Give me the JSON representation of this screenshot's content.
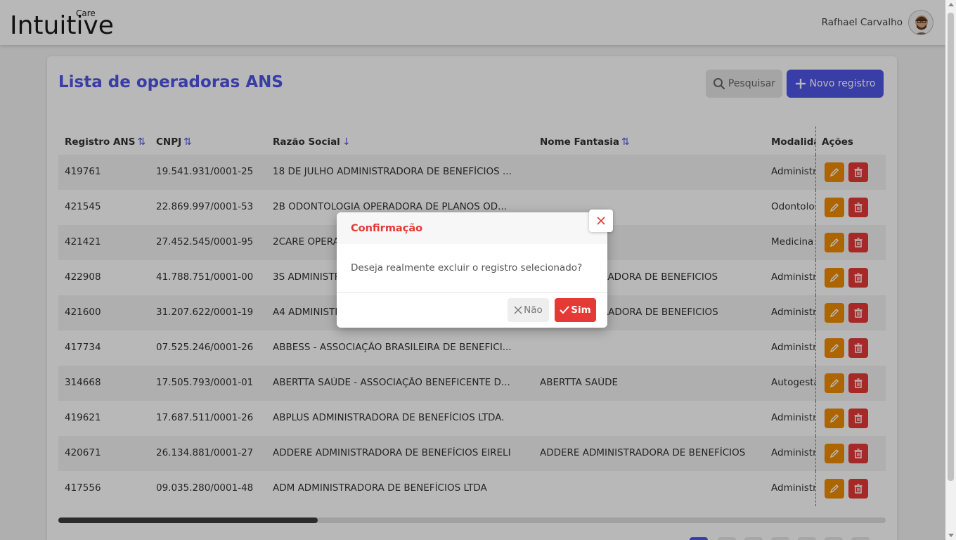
{
  "header": {
    "logo_main": "Intuitive",
    "logo_care": "Care",
    "user_name": "Rafhael Carvalho"
  },
  "page": {
    "title": "Lista de operadoras ANS",
    "search_label": "Pesquisar",
    "new_label": "Novo registro"
  },
  "table": {
    "columns": [
      "Registro ANS",
      "CNPJ",
      "Razão Social",
      "Nome Fantasia",
      "Modalidade",
      "Ações"
    ],
    "rows": [
      {
        "registro": "419761",
        "cnpj": "19.541.931/0001-25",
        "razao": "18 DE JULHO ADMINISTRADORA DE BENEFÍCIOS ...",
        "fantasia": "",
        "modalidade": "Administradora de Benefícios"
      },
      {
        "registro": "421545",
        "cnpj": "22.869.997/0001-53",
        "razao": "2B ODONTOLOGIA OPERADORA DE PLANOS OD...",
        "fantasia": "",
        "modalidade": "Odontologia de Grupo"
      },
      {
        "registro": "421421",
        "cnpj": "27.452.545/0001-95",
        "razao": "2CARE OPERADORA DE SAÚDE LTDA.",
        "fantasia": "",
        "modalidade": "Medicina de Grupo"
      },
      {
        "registro": "422908",
        "cnpj": "41.788.751/0001-00",
        "razao": "3S ADMINISTRADORA DE BENEFICIOS LTDA",
        "fantasia": "3S ADMINISTRADORA DE BENEFICIOS",
        "modalidade": "Administradora de Benefícios"
      },
      {
        "registro": "421600",
        "cnpj": "31.207.622/0001-19",
        "razao": "A4 ADMINISTRADORA DE BENEFICIOS LTDA",
        "fantasia": "A4 ADMINISTRADORA DE BENEFICIOS",
        "modalidade": "Administradora de Benefícios"
      },
      {
        "registro": "417734",
        "cnpj": "07.525.246/0001-26",
        "razao": "ABBESS - ASSOCIAÇÃO BRASILEIRA DE BENEFICI...",
        "fantasia": "",
        "modalidade": "Administradora de Benefícios"
      },
      {
        "registro": "314668",
        "cnpj": "17.505.793/0001-01",
        "razao": "ABERTTA SAÚDE - ASSOCIAÇÃO BENEFICENTE D...",
        "fantasia": "ABERTTA SAÚDE",
        "modalidade": "Autogestão"
      },
      {
        "registro": "419621",
        "cnpj": "17.687.511/0001-26",
        "razao": "ABPLUS ADMINISTRADORA DE BENEFÍCIOS LTDA.",
        "fantasia": "",
        "modalidade": "Administradora de Benefícios"
      },
      {
        "registro": "420671",
        "cnpj": "26.134.881/0001-27",
        "razao": "ADDERE ADMINISTRADORA DE BENEFÍCIOS EIRELI",
        "fantasia": "ADDERE ADMINISTRADORA DE BENEFÍCIOS",
        "modalidade": "Administradora de Benefícios"
      },
      {
        "registro": "417556",
        "cnpj": "09.035.280/0001-48",
        "razao": "ADM ADMINISTRADORA DE BENEFÍCIOS LTDA",
        "fantasia": "",
        "modalidade": "Administradora de Benefícios"
      }
    ]
  },
  "dialog": {
    "title": "Confirmação",
    "message": "Deseja realmente excluir o registro selecionado?",
    "no_label": "Não",
    "yes_label": "Sim"
  },
  "colors": {
    "primary": "#4f55e6",
    "danger": "#e53935",
    "edit": "#f08c00"
  }
}
